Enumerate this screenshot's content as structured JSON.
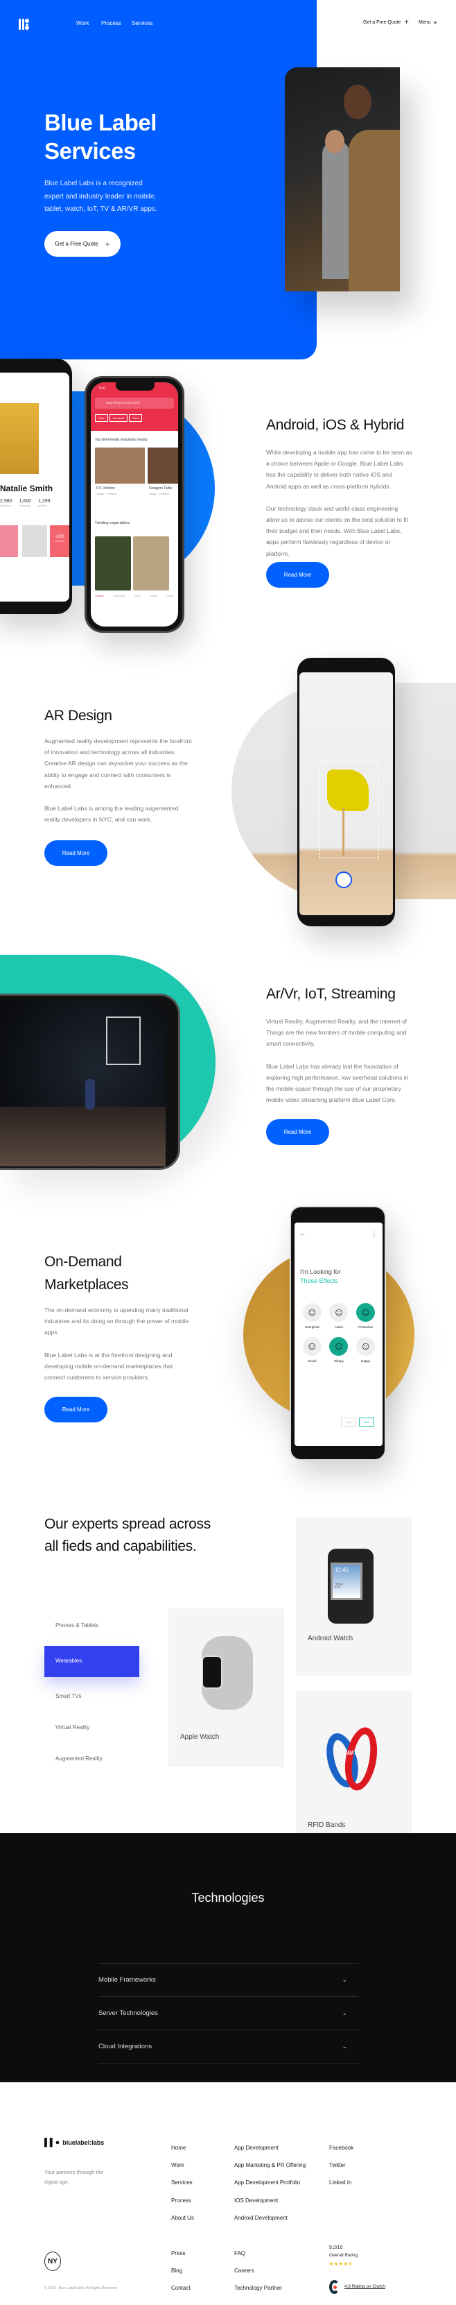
{
  "colors": {
    "brand_blue": "#005dff",
    "button_blue": "#0061ff",
    "teal": "#1ec8ae",
    "gold": "#d9a53c",
    "tab_active": "#3340ee",
    "dark": "#0d0d0d"
  },
  "nav": {
    "logo_icon": "bluelabel-logo-icon",
    "links": [
      "Work",
      "Process",
      "Services"
    ],
    "quote_label": "Get a Free Quote",
    "menu_label": "Menu"
  },
  "hero": {
    "title_line1": "Blue Label",
    "title_line2": "Services",
    "text": "Blue Label Labs is a recognized expert and industry leader in mobile, tablet, watch, IoT, TV & AR/VR apps.",
    "button": "Get a Free Quote"
  },
  "android": {
    "title": "Android, iOS & Hybrid",
    "p1": "While developing a mobile app has come to be seen as a choice between Apple or Google, Blue Label Labs has the capability to deliver both native iOS and Android apps as well as cross-platform hybrids.",
    "p2": "Our technology stack and world-class engineering allow us to advise our clients on the best solution to fit their budget and their needs. With Blue Label Labs, apps perform flawlessly regardless of device or platform.",
    "button": "Read More",
    "profile": {
      "name": "Natalie Smith",
      "stats": [
        {
          "value": "2,980",
          "label": "followers"
        },
        {
          "value": "1,600",
          "label": "following"
        },
        {
          "value": "1,299",
          "label": "photos"
        }
      ],
      "more": "+200",
      "more_label": "photos"
    },
    "app": {
      "time": "9:41",
      "search": "searching in new york",
      "filters": [
        "Filter",
        "All meals",
        "Diets"
      ],
      "heading": "Top diet-friendly resturants nearby",
      "places": [
        {
          "name": "P.S. Kitchen",
          "sub": "Vegan . Chelsea"
        },
        {
          "name": "Foragers Table",
          "sub": "Vegan . Chelsea"
        }
      ],
      "trending": "Trending vegan dishes",
      "tabs": [
        "Explore",
        "Community",
        "Deals",
        "Activity",
        "Profile"
      ]
    }
  },
  "ar": {
    "title": "AR Design",
    "p1": "Augmented reality development represents the forefront of innovation and technology across all industries. Creative AR design can skyrocket your success as the ability to engage and connect with consumers is enhanced.",
    "p2": "Blue Label Labs is among the leading augemented reality developers in NYC, and can work.",
    "button": "Read More"
  },
  "streaming": {
    "title": "Ar/Vr, IoT, Streaming",
    "p1": "Virtual Reality, Augmented Reality, and the Internet of Things are the new frontiers of mobile computing and smart connectivity.",
    "p2": "Blue Label Labs has already laid the foundation of exploring high performance, low overhead solutions in the mobile space through the use of our proprietary mobile video streaming platform Blue Label Core.",
    "button": "Read More"
  },
  "ondemand": {
    "title_line1": "On-Demand",
    "title_line2": "Marketplaces",
    "p1": "The on-demand economy is upending many traditional industries and its doing so through the power of mobile apps.",
    "p2": "Blue Label Labs is at the forefront designing and developing mobile on-demand marketplaces that connect customers to service providers.",
    "button": "Read More",
    "app": {
      "line1": "I'm Looking for",
      "line2": "These Effects",
      "effects": [
        "Energized",
        "Active",
        "Productive",
        "Social",
        "Sleepy",
        "Happy"
      ],
      "skip": "Skip",
      "next": "Next"
    }
  },
  "experts": {
    "title_line1": "Our experts spread across",
    "title_line2": "all fieds and capabilities.",
    "tabs": [
      "Phones & Tablets",
      "Wearables",
      "Smart TVs",
      "Virtual Reality",
      "Augmented Reality"
    ],
    "active_tab": "Wearables",
    "cards": [
      {
        "label": "Apple Watch"
      },
      {
        "label": "Android Watch",
        "time": "12:45",
        "temp": "22°"
      },
      {
        "label": "RFID Bands",
        "band_text": "RFID"
      }
    ]
  },
  "technologies": {
    "title": "Technologies",
    "items": [
      "Mobile Frameworks",
      "Server Technologies",
      "Cloud Integrations"
    ]
  },
  "footer": {
    "brand": "bluelabel:labs",
    "tagline": "Your partners through the digital age.",
    "col1": [
      "Home",
      "Work",
      "Services",
      "Process",
      "About Us"
    ],
    "col2": [
      "App Development",
      "App Marketing & PR Offering",
      "App Development Protfolio",
      "IOS Development",
      "Android Development"
    ],
    "col3": [
      "Facebook",
      "Twitter",
      "Linked In"
    ],
    "col1b": [
      "Press",
      "Blog",
      "Contact"
    ],
    "col2b": [
      "FAQ",
      "Careers",
      "Technology Partner"
    ],
    "badge": "NY",
    "copyright": "© 2018 - Blue Label Labs | All Rights Reserved",
    "rating": "9.2/10",
    "rating_label": "Overall Rating",
    "stars": 4.5,
    "clutch": "4.8 Rating on Clutch"
  }
}
